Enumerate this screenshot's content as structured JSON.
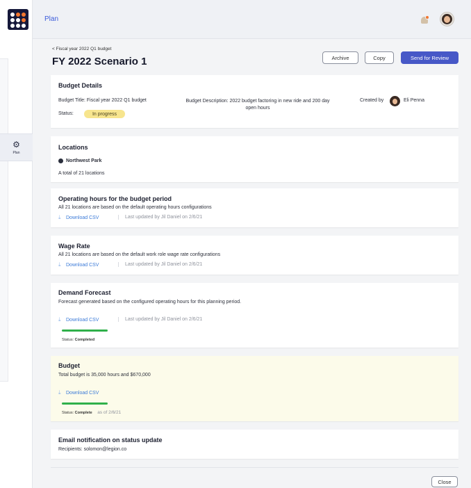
{
  "app": {
    "title": "Plan"
  },
  "sidebar": {
    "items": [
      {
        "label": "Plan"
      }
    ]
  },
  "header": {
    "breadcrumb": "< Fiscal year 2022 Q1 budget",
    "title": "FY 2022 Scenario 1",
    "actions": {
      "archive": "Archive",
      "copy": "Copy",
      "review": "Send for Review"
    }
  },
  "budget_details": {
    "title": "Budget Details",
    "budget_title": "Budget Title: Fiscal year 2022 Q1 budget",
    "description": "Budget Description: 2022 budget factoring in new ride and 200 day open hours",
    "created_by_label": "Created by",
    "created_by_name": "Eli Penna",
    "status_label": "Status:",
    "status_value": "In progress"
  },
  "locations": {
    "title": "Locations",
    "location_name": "Northwest Park",
    "total": "A total of 21 locations"
  },
  "operating_hours": {
    "title": "Operating hours for the budget period",
    "desc": "All 21 locations are based on the default operating hours configurations",
    "download": "Download CSV",
    "updated": "Last updated by Jil Daniel on 2/6/21"
  },
  "wage_rate": {
    "title": "Wage Rate",
    "desc": "All 21 locations are based on the default work role wage rate configurations",
    "download": "Download CSV",
    "updated": "Last updated by Jil Daniel on 2/6/21"
  },
  "demand_forecast": {
    "title": "Demand Forecast",
    "desc": "Forecast generated based on the configured operating hours for this planning period.",
    "download": "Download CSV",
    "updated": "Last updated by Jil Daniel on 2/6/21",
    "progress": 1.0,
    "status_label": "Status:",
    "status_value": "Completed"
  },
  "budget": {
    "title": "Budget",
    "desc": "Total budget is 35,000 hours and $670,000",
    "download": "Download CSV",
    "progress": 1.0,
    "status_label": "Status:",
    "status_value": "Complete",
    "as_of": "as of 2/6/21"
  },
  "email": {
    "title": "Email notification on status update",
    "recipients": "Recipients: solomon@legion.co"
  },
  "footer": {
    "close": "Close"
  },
  "colors": {
    "accent": "#4758c7",
    "progress": "#2fb04a",
    "status_pill": "#f7e58e",
    "budget_bg": "#fcfbea"
  },
  "icons": {
    "bell": "bell-icon",
    "download": "download-icon",
    "location": "location-pin-icon",
    "plan": "plan-gear-icon"
  }
}
